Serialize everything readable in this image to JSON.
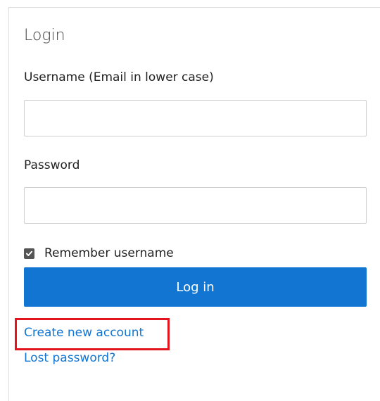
{
  "login": {
    "title": "Login",
    "username_label": "Username (Email in lower case)",
    "username_value": "",
    "password_label": "Password",
    "password_value": "",
    "remember_label": "Remember username",
    "remember_checked": true,
    "login_button": "Log in",
    "create_account_link": "Create new account",
    "lost_password_link": "Lost password?"
  },
  "colors": {
    "primary": "#1275d1",
    "highlight": "#e2141d",
    "checkbox": "#555555"
  },
  "icons": {
    "checkbox": "checkmark-icon"
  }
}
